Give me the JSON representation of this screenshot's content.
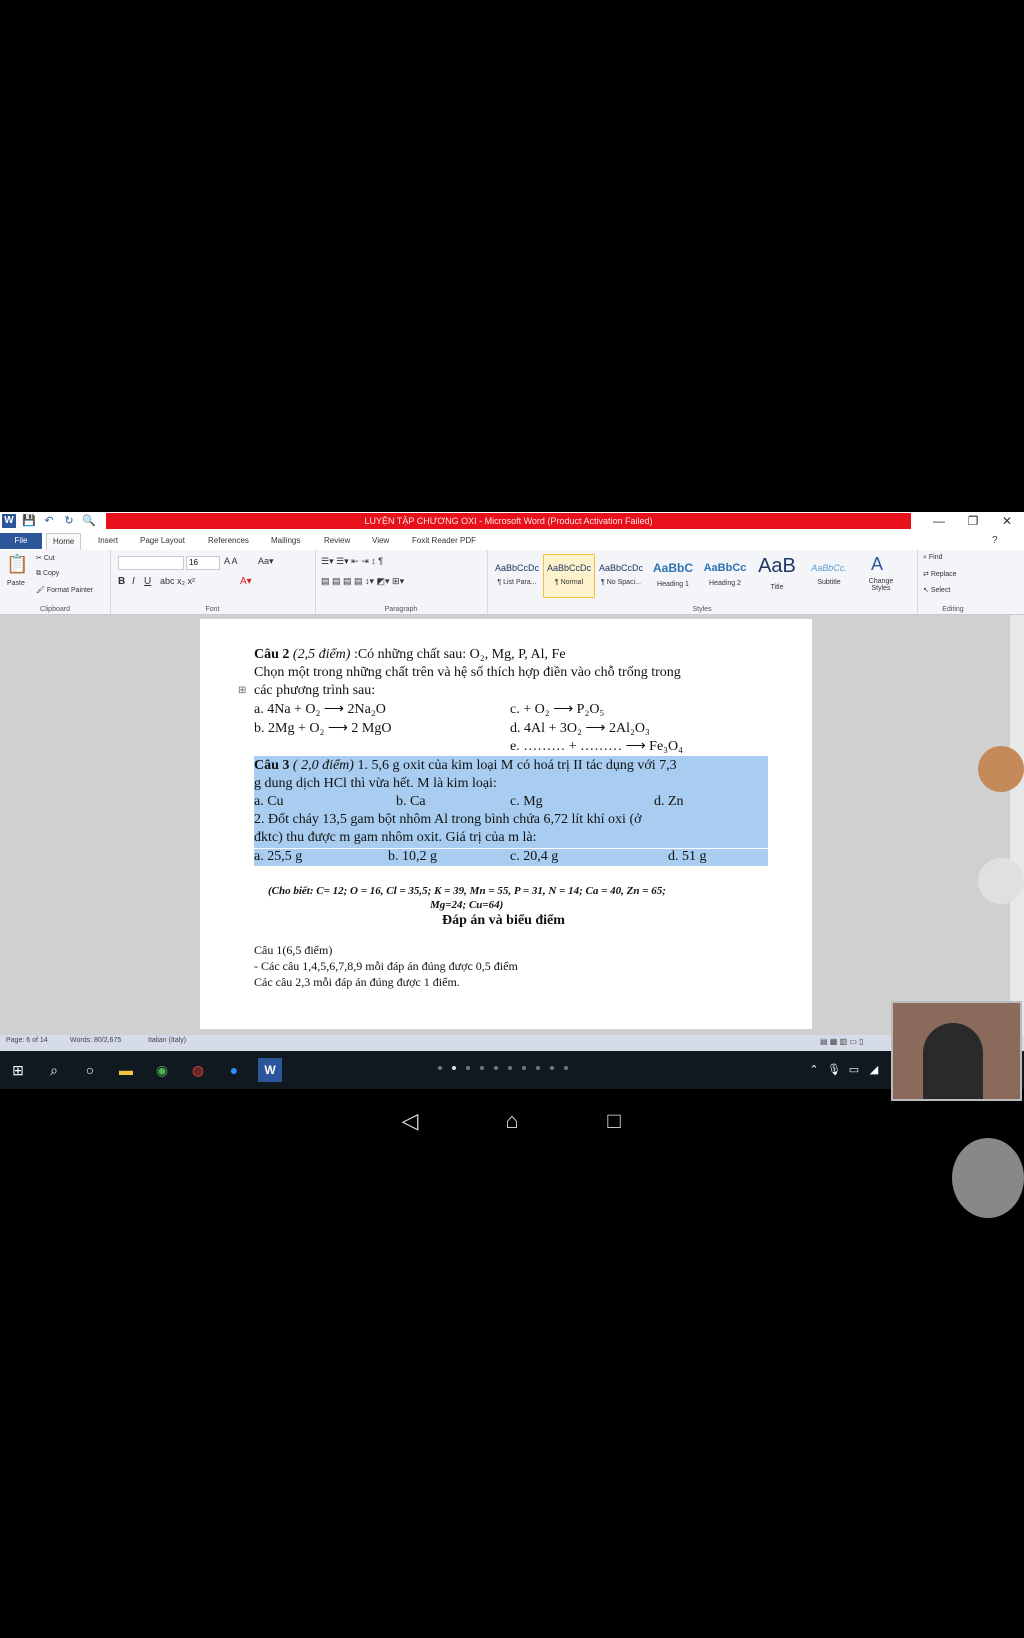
{
  "window": {
    "title": "LUYỆN TẬP CHƯƠNG OXI - Microsoft Word (Product Activation Failed)",
    "controls": [
      "—",
      "❐",
      "✕"
    ]
  },
  "ribbon": {
    "tabs": [
      "File",
      "Home",
      "Insert",
      "Page Layout",
      "References",
      "Mailings",
      "Review",
      "View",
      "Foxit Reader PDF"
    ],
    "clipboard": {
      "paste": "Paste",
      "cut": "Cut",
      "copy": "Copy",
      "format_painter": "Format Painter",
      "label": "Clipboard"
    },
    "font": {
      "size": "16",
      "label": "Font"
    },
    "paragraph": {
      "label": "Paragraph"
    },
    "styles": {
      "label": "Styles",
      "items": [
        {
          "sample": "AaBbCcDc",
          "name": "¶ List Para..."
        },
        {
          "sample": "AaBbCcDc",
          "name": "¶ Normal"
        },
        {
          "sample": "AaBbCcDc",
          "name": "¶ No Spaci..."
        },
        {
          "sample": "AaBbC",
          "name": "Heading 1"
        },
        {
          "sample": "AaBbCc",
          "name": "Heading 2"
        },
        {
          "sample": "AaB",
          "name": "Title"
        },
        {
          "sample": "AaBbCc.",
          "name": "Subtitle"
        }
      ],
      "change_styles": "Change Styles"
    },
    "editing": {
      "find": "Find",
      "replace": "Replace",
      "select": "Select",
      "label": "Editing"
    }
  },
  "document": {
    "q2_title": "Câu 2",
    "q2_points": "(2,5 điểm)",
    "q2_text": " :Có những chất sau: O₂, Mg, P, Al, Fe",
    "q2_line2": "Chọn một trong những chất trên và hệ số thích hợp điền vào chỗ trống trong",
    "q2_line3": "các phương trình sau:",
    "eq_a": "a.  4Na + O₂ ⟶ 2Na₂O",
    "eq_b": "b.  2Mg + O₂ ⟶ 2 MgO",
    "eq_c": "c.   +  O₂ ⟶  P₂O₅",
    "eq_d": "d.   4Al + 3O₂ ⟶ 2Al₂O₃",
    "eq_e": "e.   ……… + ……… ⟶ Fe₃O₄",
    "q3_title": "Câu 3",
    "q3_points": "( 2,0 điểm)",
    "q3_line1": " 1.   5,6 g oxit của kim loại M có hoá trị II tác dụng với 7,3",
    "q3_line2": "g dung dịch HCl thì vừa hết.  M là kim loại:",
    "q3_opts1": [
      "a. Cu",
      "b. Ca",
      "c. Mg",
      "d. Zn"
    ],
    "q3_line3": "   2.    Đốt cháy 13,5 gam bột nhôm Al trong bình chứa 6,72 lít khí oxi (ở",
    "q3_line4": "đktc)  thu được m gam nhôm oxit. Giá trị của m là:",
    "q3_opts2": [
      "a. 25,5 g",
      "b. 10,2 g",
      "c. 20,4 g",
      "d. 51 g"
    ],
    "given_line1": "(Cho biết: C= 12; O = 16, Cl = 35,5; K = 39, Mn = 55, P = 31, N = 14; Ca = 40, Zn = 65;",
    "given_line2": "Mg=24;                    Cu=64)",
    "answer_title": "Đáp án và biểu điểm",
    "ans_line1": "Câu 1(6,5 điểm)",
    "ans_line2": "- Các câu  1,4,5,6,7,8,9 mỗi đáp án đúng được 0,5 điểm",
    "ans_line3": "  Các câu 2,3 mỗi đáp án đúng được 1 điểm."
  },
  "status_bar": {
    "page": "Page: 6 of 14",
    "words": "Words: 80/2,675",
    "language": "Italian (Italy)"
  },
  "colors": {
    "title_bar_red": "#e8101a",
    "selection": "#a9cdf0",
    "taskbar": "#101820"
  }
}
